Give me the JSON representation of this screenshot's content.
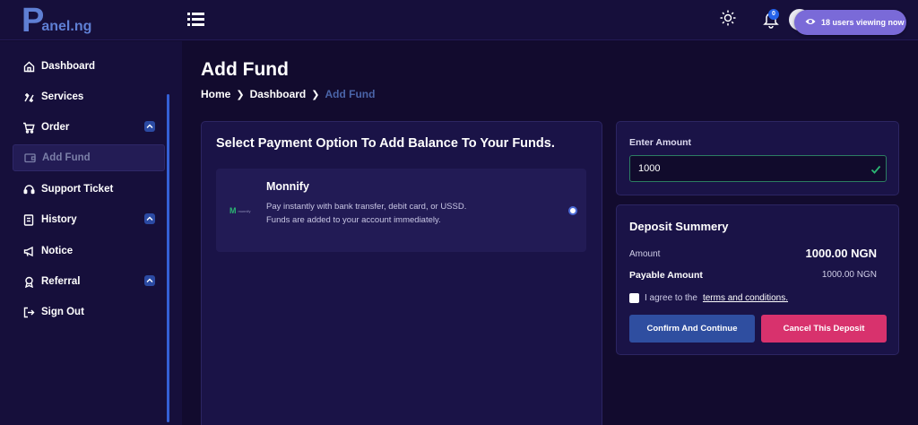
{
  "header": {
    "logo_initial": "P",
    "logo_rest": "anel.ng",
    "notification_count": "0",
    "viewing_text": "18 users viewing now"
  },
  "sidebar": {
    "items": [
      {
        "label": "Dashboard",
        "icon": "home-icon"
      },
      {
        "label": "Services",
        "icon": "services-icon"
      },
      {
        "label": "Order",
        "icon": "cart-icon",
        "expandable": true
      },
      {
        "label": "Add Fund",
        "icon": "wallet-icon",
        "active": true
      },
      {
        "label": "Support Ticket",
        "icon": "headset-icon"
      },
      {
        "label": "History",
        "icon": "history-icon",
        "expandable": true
      },
      {
        "label": "Notice",
        "icon": "megaphone-icon"
      },
      {
        "label": "Referral",
        "icon": "referral-icon",
        "expandable": true
      },
      {
        "label": "Sign Out",
        "icon": "sign-out-icon"
      }
    ]
  },
  "page": {
    "title": "Add Fund",
    "breadcrumb": [
      "Home",
      "Dashboard",
      "Add Fund"
    ]
  },
  "payment": {
    "heading": "Select Payment Option To Add Balance To Your Funds.",
    "method": {
      "name": "Monnify",
      "logo_text": "monnify",
      "description": "Pay instantly with bank transfer, debit card, or USSD. Funds are added to your account immediately.",
      "selected": true
    }
  },
  "amount": {
    "label": "Enter Amount",
    "value": "1000"
  },
  "summary": {
    "title": "Deposit Summery",
    "amount_label": "Amount",
    "amount_value": "1000.00 NGN",
    "payable_label": "Payable Amount",
    "payable_value": "1000.00 NGN",
    "terms_prefix": "I agree to the",
    "terms_link": "terms and conditions.",
    "confirm_label": "Confirm And Continue",
    "cancel_label": "Cancel This Deposit"
  },
  "colors": {
    "background": "#120b2e",
    "panel": "#1a1347",
    "accent_blue": "#2f4ea0",
    "accent_pink": "#d8326d",
    "success_green": "#2bb673"
  }
}
